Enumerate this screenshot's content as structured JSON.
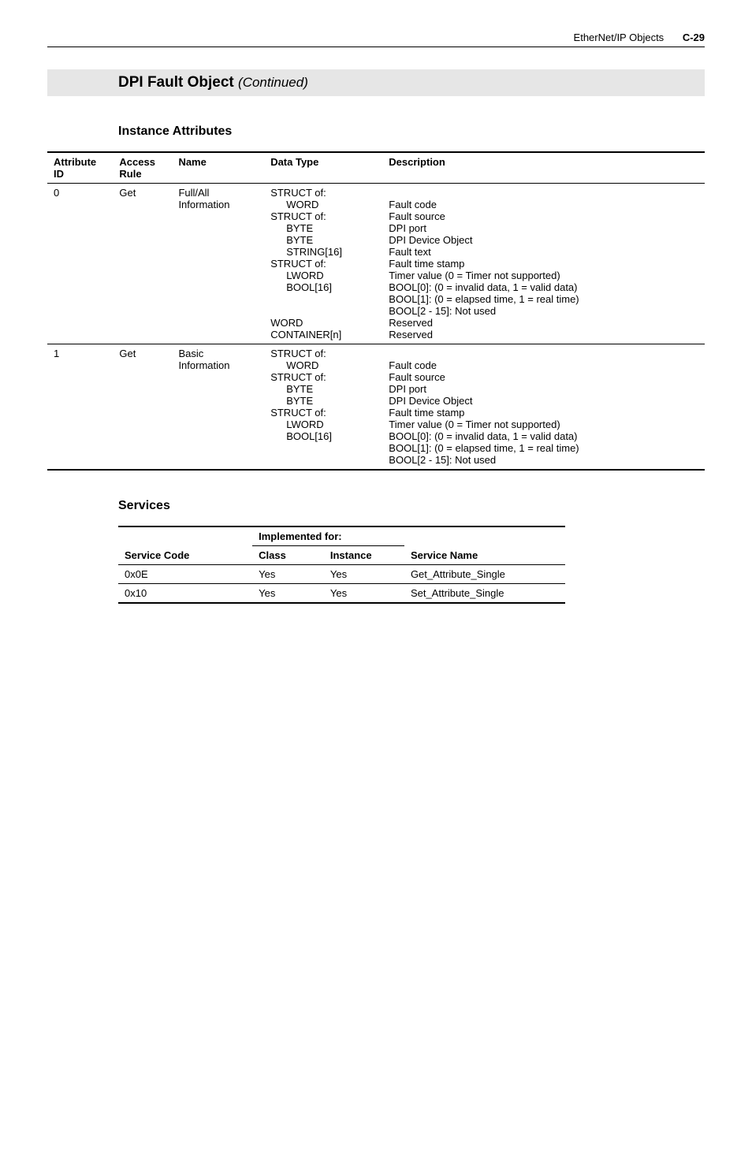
{
  "header": {
    "chapter": "EtherNet/IP Objects",
    "page": "C-29"
  },
  "title": {
    "main": "DPI Fault Object",
    "cont": "(Continued)"
  },
  "instance": {
    "heading": "Instance Attributes",
    "columns": {
      "attrid": "Attribute ID",
      "access": "Access Rule",
      "name": "Name",
      "datatype": "Data Type",
      "desc": "Description"
    },
    "rows": [
      {
        "id": "0",
        "access": "Get",
        "name_l1": "Full/All",
        "name_l2": "Information",
        "dt": {
          "l0": "STRUCT of:",
          "l1": "WORD",
          "l2": "STRUCT of:",
          "l3": "BYTE",
          "l4": "BYTE",
          "l5": "STRING[16]",
          "l6": "STRUCT of:",
          "l7": "LWORD",
          "l8": "BOOL[16]",
          "l9": "WORD",
          "l10": "CONTAINER[n]"
        },
        "d": {
          "l1": "Fault code",
          "l2": "Fault source",
          "l3": "DPI port",
          "l4": "DPI Device Object",
          "l5": "Fault text",
          "l6": "Fault time stamp",
          "l7": "Timer value (0 = Timer not supported)",
          "l8": "BOOL[0]: (0 = invalid data, 1 = valid data)",
          "l8b": "BOOL[1]: (0 = elapsed time, 1 = real time)",
          "l8c": "BOOL[2 - 15]: Not used",
          "l9": "Reserved",
          "l10": "Reserved"
        }
      },
      {
        "id": "1",
        "access": "Get",
        "name_l1": "Basic",
        "name_l2": "Information",
        "dt": {
          "l0": "STRUCT of:",
          "l1": "WORD",
          "l2": "STRUCT of:",
          "l3": "BYTE",
          "l4": "BYTE",
          "l6": "STRUCT of:",
          "l7": "LWORD",
          "l8": "BOOL[16]"
        },
        "d": {
          "l1": "Fault code",
          "l2": "Fault source",
          "l3": "DPI port",
          "l4": "DPI Device Object",
          "l6": "Fault time stamp",
          "l7": "Timer value (0 = Timer not supported)",
          "l8": "BOOL[0]: (0 = invalid data, 1 = valid data)",
          "l8b": "BOOL[1]: (0 = elapsed time, 1 = real time)",
          "l8c": "BOOL[2 - 15]: Not used"
        }
      }
    ]
  },
  "services": {
    "heading": "Services",
    "columns": {
      "code": "Service Code",
      "impl": "Implemented for:",
      "class": "Class",
      "instance": "Instance",
      "name": "Service Name"
    },
    "rows": [
      {
        "code": "0x0E",
        "class": "Yes",
        "instance": "Yes",
        "name": "Get_Attribute_Single"
      },
      {
        "code": "0x10",
        "class": "Yes",
        "instance": "Yes",
        "name": "Set_Attribute_Single"
      }
    ]
  }
}
